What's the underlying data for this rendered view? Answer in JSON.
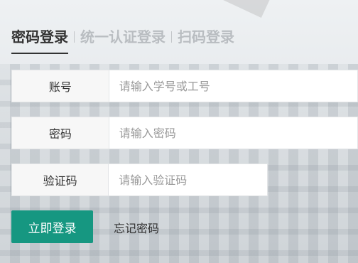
{
  "tabs": [
    {
      "label": "密码登录",
      "active": true
    },
    {
      "label": "统一认证登录",
      "active": false
    },
    {
      "label": "扫码登录",
      "active": false
    }
  ],
  "form": {
    "account": {
      "label": "账号",
      "placeholder": "请输入学号或工号",
      "value": ""
    },
    "password": {
      "label": "密码",
      "placeholder": "请输入密码",
      "value": ""
    },
    "captcha": {
      "label": "验证码",
      "placeholder": "请输入验证码",
      "value": ""
    }
  },
  "actions": {
    "login_label": "立即登录",
    "forgot_label": "忘记密码"
  },
  "colors": {
    "accent": "#169781",
    "tab_active": "#333333",
    "tab_inactive": "#b9bdc1"
  }
}
